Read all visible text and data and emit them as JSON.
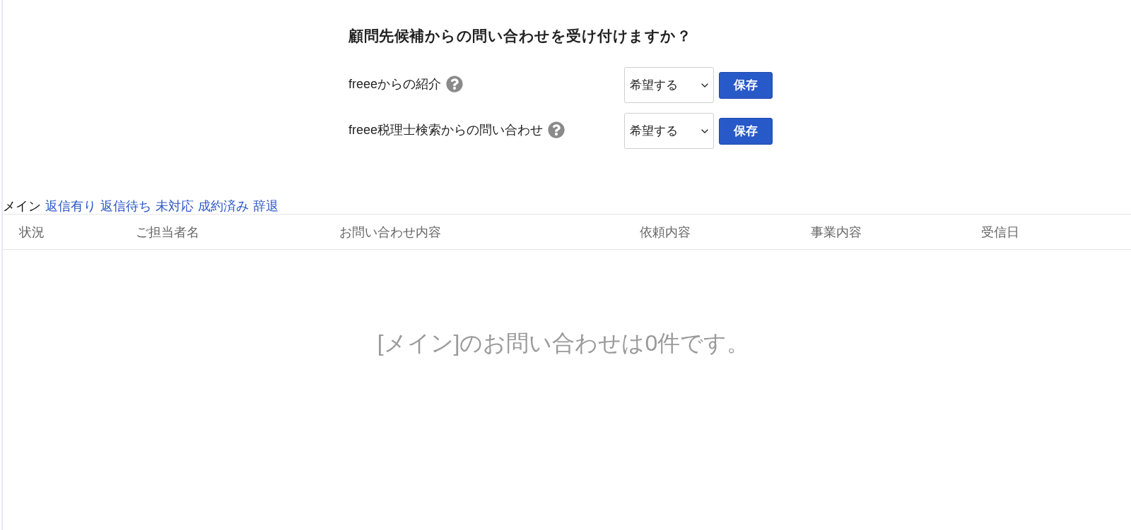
{
  "heading": "顧問先候補からの問い合わせを受け付けますか？",
  "settings": [
    {
      "label": "freeeからの紹介",
      "select": {
        "value": "希望する"
      },
      "button": "保存"
    },
    {
      "label": "freee税理士検索からの問い合わせ",
      "select": {
        "value": "希望する"
      },
      "button": "保存"
    }
  ],
  "tabs": [
    {
      "label": "メイン",
      "selected": true
    },
    {
      "label": "返信有り",
      "selected": false
    },
    {
      "label": "返信待ち",
      "selected": false
    },
    {
      "label": "未対応",
      "selected": false
    },
    {
      "label": "成約済み",
      "selected": false
    },
    {
      "label": "辞退",
      "selected": false
    }
  ],
  "table": {
    "columns": [
      "状況",
      "ご担当者名",
      "お問い合わせ内容",
      "依頼内容",
      "事業内容",
      "受信日"
    ],
    "empty_message": "[メイン]のお問い合わせは0件です。"
  }
}
